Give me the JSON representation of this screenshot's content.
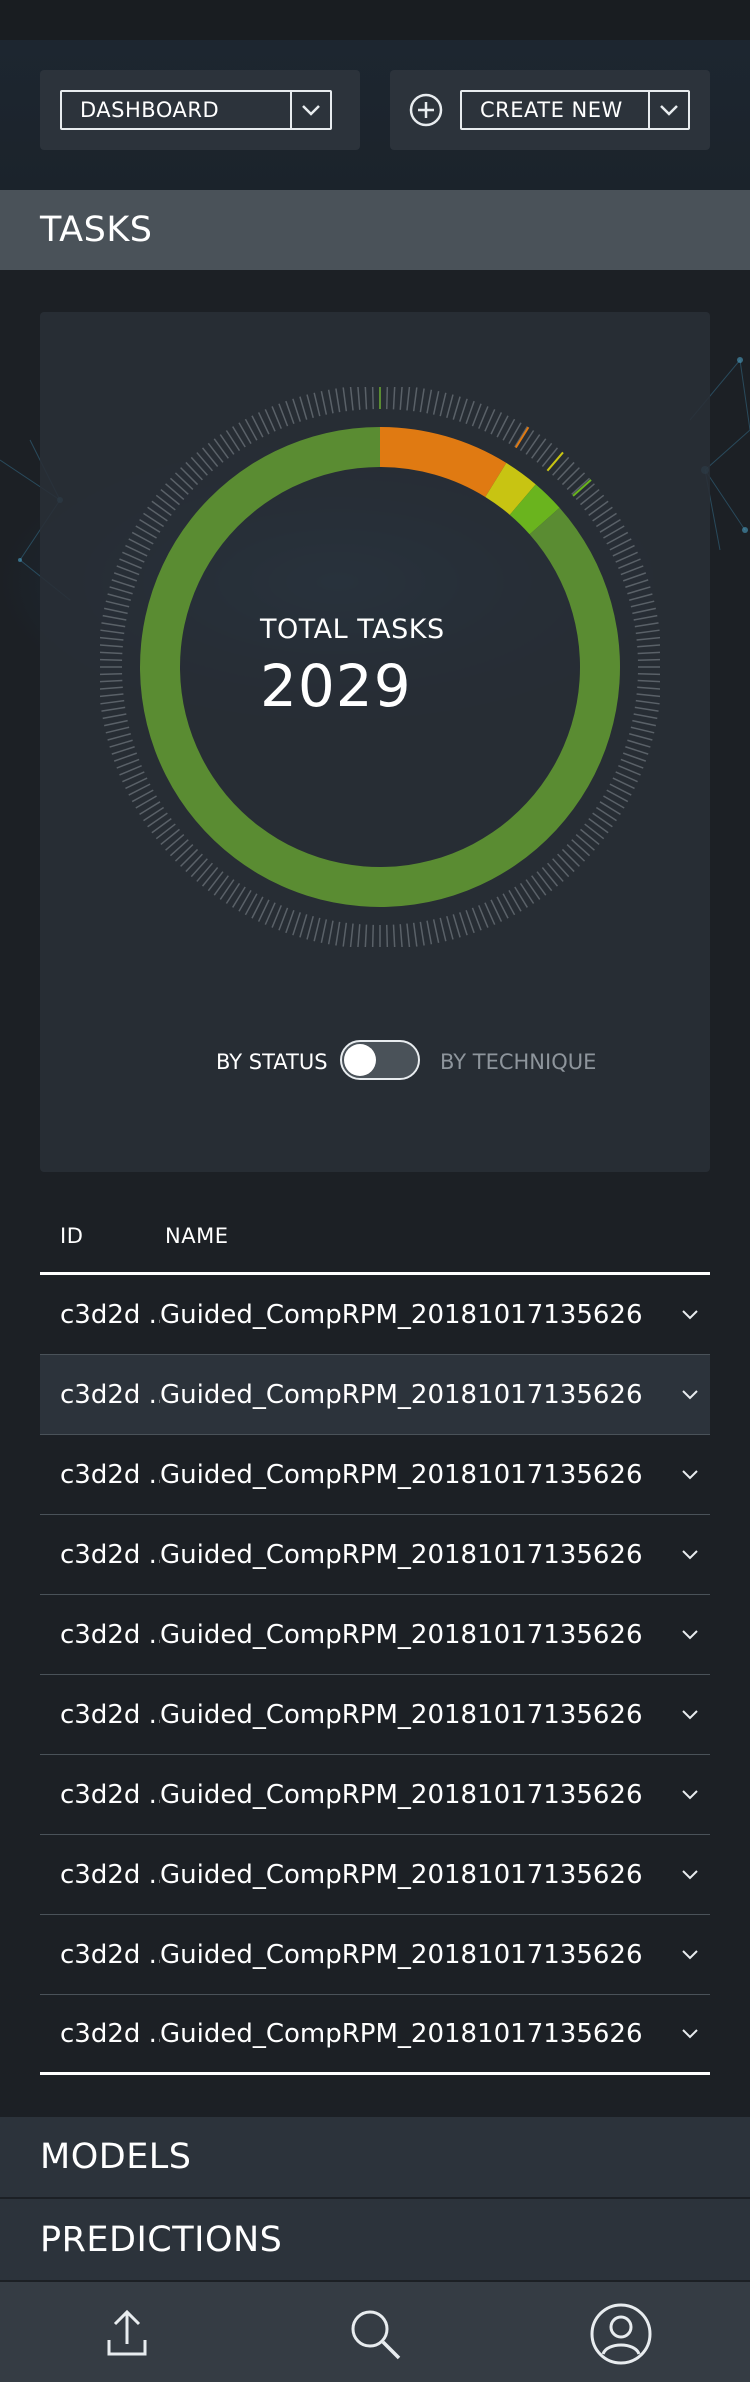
{
  "header": {
    "view_select": {
      "label": "DASHBOARD"
    },
    "create_select": {
      "label": "CREATE NEW"
    }
  },
  "sections": {
    "tasks": "TASKS",
    "models": "MODELS",
    "predictions": "PREDICTIONS"
  },
  "chart": {
    "center_label": "TOTAL TASKS",
    "center_value": "2029",
    "toggle": {
      "left_label": "BY STATUS",
      "right_label": "BY TECHNIQUE",
      "selected": "left"
    }
  },
  "chart_data": {
    "type": "pie",
    "donut": true,
    "total": 2029,
    "categories": [
      "green",
      "orange",
      "yellow",
      "light-green"
    ],
    "values": [
      1756,
      179,
      49,
      45
    ],
    "colors": [
      "#5a8c32",
      "#e07a12",
      "#c8c412",
      "#6ab41e"
    ]
  },
  "table": {
    "columns": {
      "id": "ID",
      "name": "NAME"
    },
    "rows": [
      {
        "id": "c3d2d ...",
        "name": "Guided_CompRPM_20181017135626"
      },
      {
        "id": "c3d2d ...",
        "name": "Guided_CompRPM_20181017135626"
      },
      {
        "id": "c3d2d ...",
        "name": "Guided_CompRPM_20181017135626"
      },
      {
        "id": "c3d2d ...",
        "name": "Guided_CompRPM_20181017135626"
      },
      {
        "id": "c3d2d ...",
        "name": "Guided_CompRPM_20181017135626"
      },
      {
        "id": "c3d2d ...",
        "name": "Guided_CompRPM_20181017135626"
      },
      {
        "id": "c3d2d ...",
        "name": "Guided_CompRPM_20181017135626"
      },
      {
        "id": "c3d2d ...",
        "name": "Guided_CompRPM_20181017135626"
      },
      {
        "id": "c3d2d ...",
        "name": "Guided_CompRPM_20181017135626"
      },
      {
        "id": "c3d2d ...",
        "name": "Guided_CompRPM_20181017135626"
      }
    ]
  },
  "icons": {
    "upload": "upload-icon",
    "search": "search-icon",
    "profile": "user-icon",
    "add": "plus-circle-icon",
    "caret": "chevron-down-icon"
  },
  "colors": {
    "background": "#1c2025",
    "panel": "#2c333b",
    "section_header_active": "#4a5259",
    "accent_text": "#ffffff",
    "muted_text": "#8e959c"
  }
}
